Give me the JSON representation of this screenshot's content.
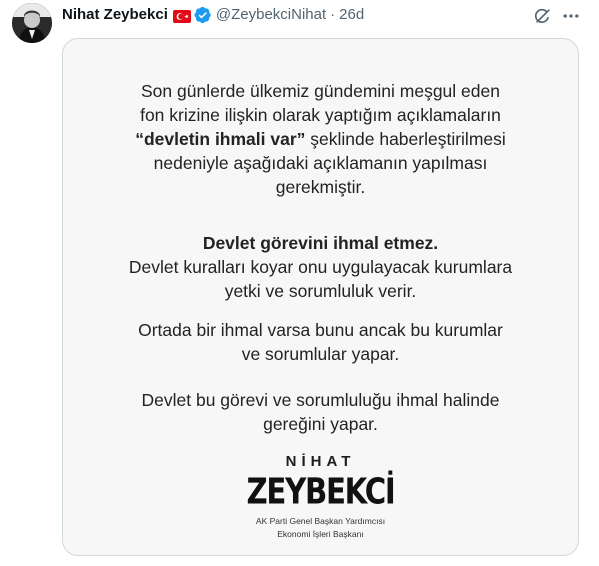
{
  "author": {
    "display_name": "Nihat Zeybekci",
    "handle": "@ZeybekciNihat",
    "separator": "·",
    "time": "26d",
    "flag_icon": "turkey-flag-icon",
    "verified_icon": "verified-badge-icon",
    "verified_color": "#1d9bf0"
  },
  "actions": {
    "grok_icon": "grok-icon",
    "more_icon": "more-icon"
  },
  "card": {
    "paragraph1": [
      "Son günlerde ülkemiz gündemini meşgul eden",
      "fon krizine ilişkin olarak yaptığım açıklamaların",
      "“devletin ihmali var”",
      " şeklinde haberleştirilmesi",
      "nedeniyle aşağıdaki açıklamanın yapılması",
      "gerekmiştir."
    ],
    "paragraph2": [
      "Devlet görevini ihmal etmez.",
      "Devlet kuralları koyar onu uygulayacak kurumlara",
      "yetki ve sorumluluk verir."
    ],
    "paragraph3": [
      "Ortada bir ihmal varsa bunu ancak bu kurumlar",
      "ve sorumlular yapar."
    ],
    "paragraph4": [
      "Devlet bu görevi ve sorumluluğu ihmal halinde",
      "gereğini yapar."
    ],
    "signature": {
      "first": "NİHAT",
      "last": "ZEYBEKCİ",
      "title1": "AK Parti Genel Başkan Yardımcısı",
      "title2": "Ekonomi İşleri Başkanı"
    }
  }
}
